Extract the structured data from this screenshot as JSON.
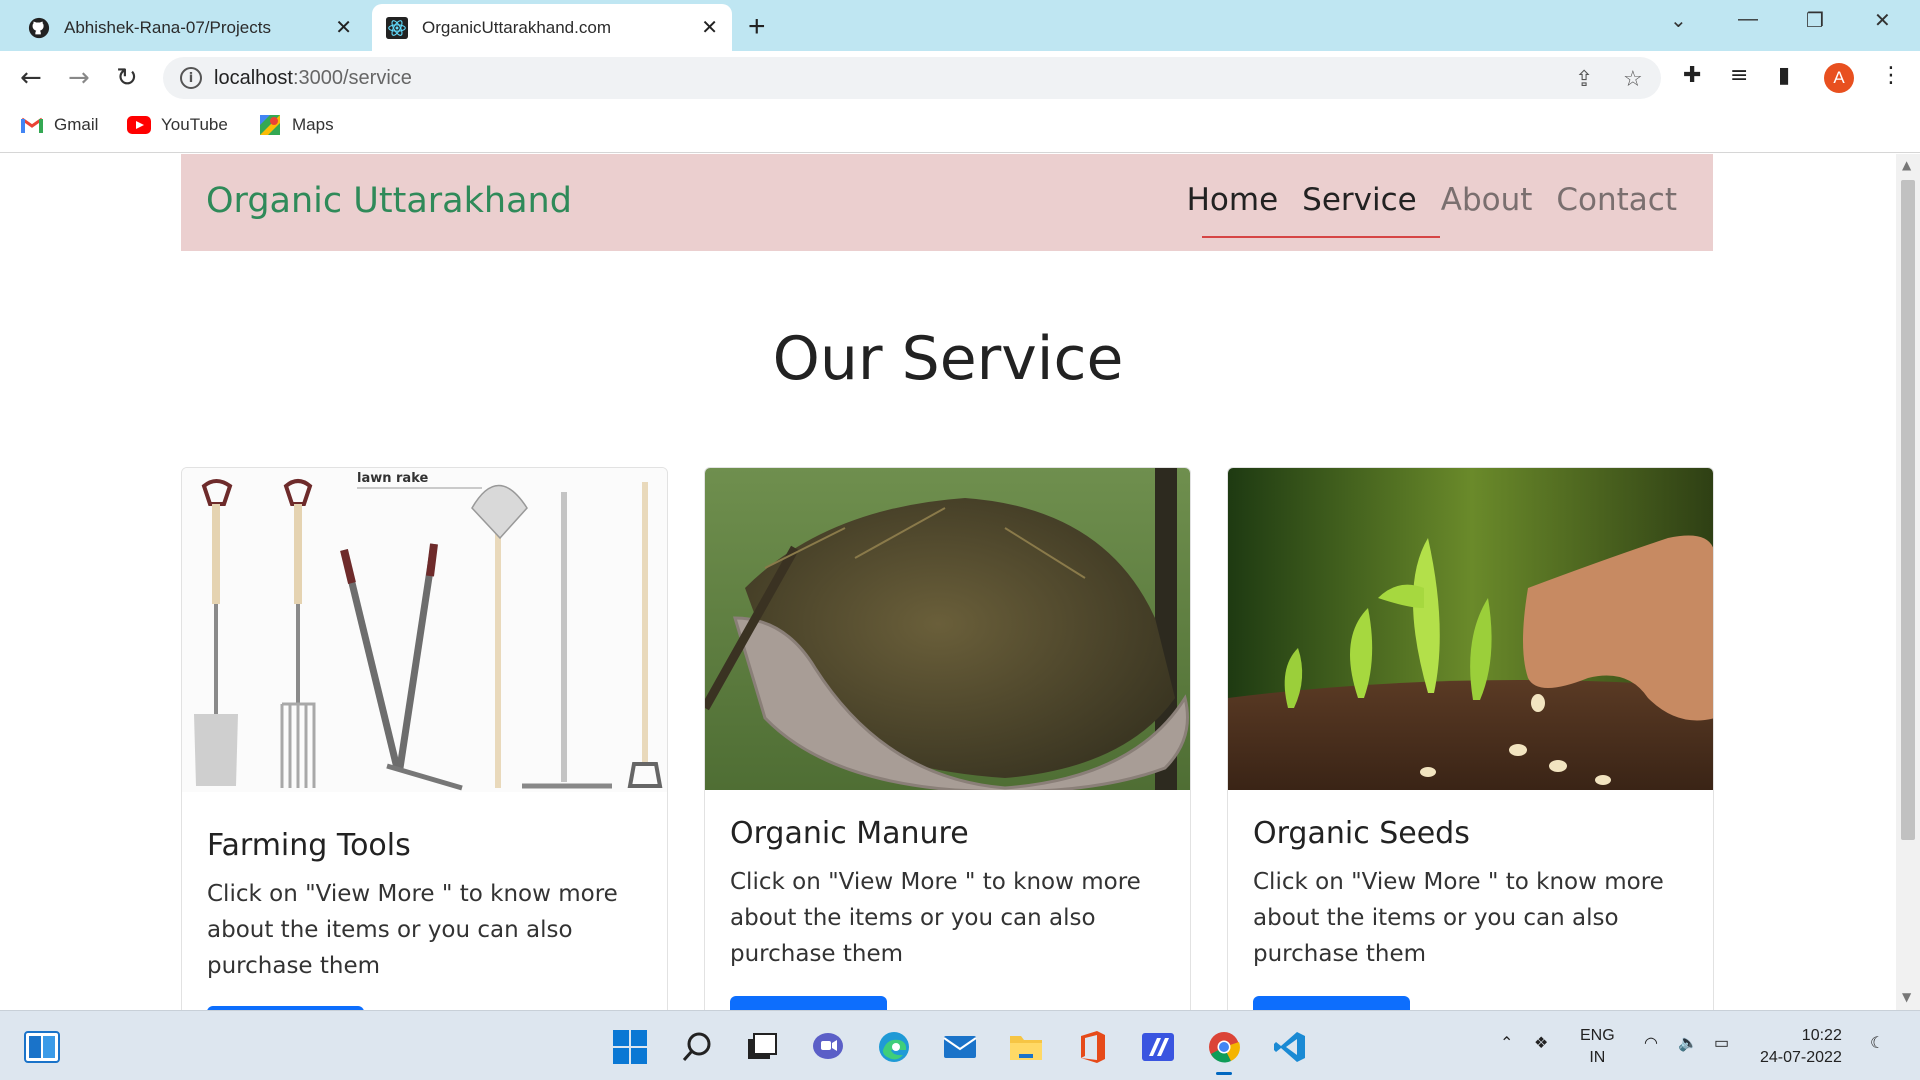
{
  "browser": {
    "tabs": [
      {
        "title": "Abhishek-Rana-07/Projects",
        "icon": "github-icon"
      },
      {
        "title": "OrganicUttarakhand.com",
        "icon": "react-icon"
      }
    ],
    "url_host": "localhost",
    "url_path": ":3000/service",
    "profile_initial": "A",
    "bookmarks": [
      {
        "label": "Gmail",
        "icon": "gmail-icon"
      },
      {
        "label": "YouTube",
        "icon": "youtube-icon"
      },
      {
        "label": "Maps",
        "icon": "maps-icon"
      }
    ]
  },
  "site": {
    "brand": "Organic Uttarakhand",
    "nav": [
      "Home",
      "Service",
      "About",
      "Contact"
    ],
    "active_nav": "Service",
    "heading": "Our Service",
    "cards": [
      {
        "title": "Farming Tools",
        "image_label": "lawn rake",
        "description": "Click on \"View More \" to know more about the items or you can also purchase them"
      },
      {
        "title": "Organic Manure",
        "description": "Click on \"View More \" to know more about the items or you can also purchase them"
      },
      {
        "title": "Organic Seeds",
        "description": "Click on \"View More \" to know more about the items or you can also purchase them"
      }
    ],
    "colors": {
      "nav_bg": "#ebcfcf",
      "brand": "#2f8a59",
      "button": "#0d6efd",
      "underline": "#d64545"
    }
  },
  "taskbar": {
    "language": "ENG",
    "region": "IN",
    "time": "10:22",
    "date": "24-07-2022"
  }
}
